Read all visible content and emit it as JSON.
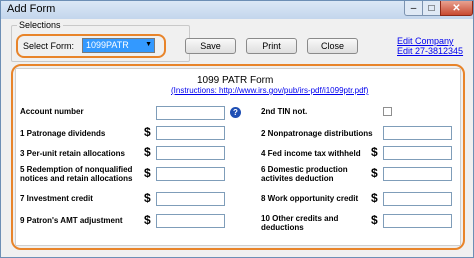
{
  "window": {
    "title": "Add Form",
    "controls": {
      "minimize": "–",
      "maximize": "□",
      "close": "✕"
    }
  },
  "selections": {
    "group_label": "Selections",
    "select_label": "Select Form:",
    "select_value": "1099PATR",
    "dropdown_arrow": "▼"
  },
  "toolbar": {
    "save_label": "Save",
    "print_label": "Print",
    "close_label": "Close"
  },
  "links": {
    "edit_company": "Edit Company",
    "edit_phone": "Edit 27-3812345"
  },
  "form": {
    "title": "1099 PATR Form",
    "instructions": "(Instructions: http://www.irs.gov/pub/irs-pdf/i1099ptr.pdf)",
    "help_icon_text": "?",
    "currency_symbol": "$",
    "left_fields": [
      {
        "label": "Account number"
      },
      {
        "label": "1 Patronage dividends"
      },
      {
        "label": "3 Per-unit retain allocations"
      },
      {
        "label_line1": "5 Redemption of nonqualified",
        "label_line2": "notices and retain allocations"
      },
      {
        "label": "7 Investment credit"
      },
      {
        "label": "9 Patron's AMT adjustment"
      }
    ],
    "right_fields": [
      {
        "label": "2nd TIN not."
      },
      {
        "label": "2 Nonpatronage distributions"
      },
      {
        "label": "4    Fed income tax withheld"
      },
      {
        "label_line1": "6 Domestic production",
        "label_line2": "activites deduction"
      },
      {
        "label": "8 Work opportunity credit"
      },
      {
        "label_line1": "10 Other credits and",
        "label_line2": "deductions"
      }
    ]
  },
  "colors": {
    "highlight_ring": "#e8842a",
    "selected_background": "#3399ff",
    "link": "#0000ee"
  }
}
